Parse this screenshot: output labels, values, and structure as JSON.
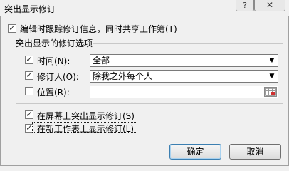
{
  "window": {
    "title": "突出显示修订",
    "help_label": "?",
    "close_label": "✕"
  },
  "track_changes": {
    "checked": true,
    "label": "编辑时跟踪修订信息，同时共享工作簿(T)"
  },
  "group": {
    "title": "突出显示的修订选项",
    "time": {
      "checked": true,
      "label": "时间(N):",
      "value": "全部"
    },
    "who": {
      "checked": true,
      "label": "修订人(O):",
      "value": "除我之外每个人"
    },
    "where": {
      "checked": false,
      "label": "位置(R):",
      "value": ""
    }
  },
  "options": {
    "on_screen": {
      "checked": true,
      "label": "在屏幕上突出显示修订(S)"
    },
    "new_sheet": {
      "checked": true,
      "label": "在新工作表上显示修订(L)"
    }
  },
  "buttons": {
    "ok": "确定",
    "cancel": "取消"
  },
  "icons": {
    "check": "✓",
    "dropdown": "▼"
  }
}
